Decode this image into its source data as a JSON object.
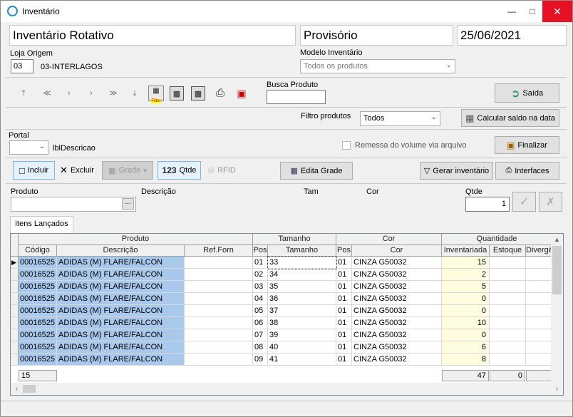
{
  "window": {
    "title": "Inventário"
  },
  "header": {
    "title": "Inventário Rotativo",
    "status": "Provisório",
    "date": "25/06/2021"
  },
  "loja": {
    "label": "Loja Origem",
    "code": "03",
    "name": "03-INTERLAGOS"
  },
  "modelo": {
    "label": "Modelo Inventário",
    "value": "Todos os produtos"
  },
  "busca": {
    "label": "Busca Produto",
    "value": ""
  },
  "toolbar": {
    "filter_badge": "Filter"
  },
  "buttons": {
    "saida": "Saída",
    "calcular": "Calcular saldo na data",
    "finalizar": "Finalizar",
    "incluir": "Incluir",
    "excluir": "Excluir",
    "grade": "Grade",
    "qtde": "Qtde",
    "qtde_prefix": "123",
    "rfid": "RFID",
    "edita_grade": "Edita Grade",
    "gerar": "Gerar inventário",
    "interfaces": "Interfaces"
  },
  "filtro": {
    "label": "Filtro produtos",
    "value": "Todos"
  },
  "portal": {
    "label": "Portal",
    "value": "",
    "desc": "lblDescricao"
  },
  "remessa": {
    "label": "Remessa do volume via arquivo",
    "checked": false
  },
  "entry": {
    "produto_label": "Produto",
    "descricao_label": "Descrição",
    "tam_label": "Tam",
    "cor_label": "Cor",
    "qtde_label": "Qtde",
    "produto_value": "",
    "qtde_value": "1",
    "dots": "..."
  },
  "tab": {
    "label": "Itens Lançados"
  },
  "grid": {
    "group_headers": [
      "Produto",
      "Tamanho",
      "Cor",
      "Quantidade"
    ],
    "col_headers": [
      "Código",
      "Descrição",
      "Ref.Forn",
      "Pos",
      "Tamanho",
      "Pos",
      "Cor",
      "Inventariada",
      "Estoque",
      "Divergê"
    ],
    "rows": [
      {
        "codigo": "00016525",
        "descricao": "ADIDAS (M) FLARE/FALCON",
        "ref": "",
        "pos_t": "01",
        "tam": "33",
        "pos_c": "01",
        "cor": "CINZA G50032",
        "inv": "15",
        "est": "",
        "div": ""
      },
      {
        "codigo": "00016525",
        "descricao": "ADIDAS (M) FLARE/FALCON",
        "ref": "",
        "pos_t": "02",
        "tam": "34",
        "pos_c": "01",
        "cor": "CINZA G50032",
        "inv": "2",
        "est": "",
        "div": ""
      },
      {
        "codigo": "00016525",
        "descricao": "ADIDAS (M) FLARE/FALCON",
        "ref": "",
        "pos_t": "03",
        "tam": "35",
        "pos_c": "01",
        "cor": "CINZA G50032",
        "inv": "5",
        "est": "",
        "div": ""
      },
      {
        "codigo": "00016525",
        "descricao": "ADIDAS (M) FLARE/FALCON",
        "ref": "",
        "pos_t": "04",
        "tam": "36",
        "pos_c": "01",
        "cor": "CINZA G50032",
        "inv": "0",
        "est": "",
        "div": ""
      },
      {
        "codigo": "00016525",
        "descricao": "ADIDAS (M) FLARE/FALCON",
        "ref": "",
        "pos_t": "05",
        "tam": "37",
        "pos_c": "01",
        "cor": "CINZA G50032",
        "inv": "0",
        "est": "",
        "div": ""
      },
      {
        "codigo": "00016525",
        "descricao": "ADIDAS (M) FLARE/FALCON",
        "ref": "",
        "pos_t": "06",
        "tam": "38",
        "pos_c": "01",
        "cor": "CINZA G50032",
        "inv": "10",
        "est": "",
        "div": ""
      },
      {
        "codigo": "00016525",
        "descricao": "ADIDAS (M) FLARE/FALCON",
        "ref": "",
        "pos_t": "07",
        "tam": "39",
        "pos_c": "01",
        "cor": "CINZA G50032",
        "inv": "0",
        "est": "",
        "div": ""
      },
      {
        "codigo": "00016525",
        "descricao": "ADIDAS (M) FLARE/FALCON",
        "ref": "",
        "pos_t": "08",
        "tam": "40",
        "pos_c": "01",
        "cor": "CINZA G50032",
        "inv": "6",
        "est": "",
        "div": ""
      },
      {
        "codigo": "00016525",
        "descricao": "ADIDAS (M) FLARE/FALCON",
        "ref": "",
        "pos_t": "09",
        "tam": "41",
        "pos_c": "01",
        "cor": "CINZA G50032",
        "inv": "8",
        "est": "",
        "div": ""
      }
    ],
    "footer": {
      "count": "15",
      "inv_total": "47",
      "est_total": "0"
    }
  }
}
